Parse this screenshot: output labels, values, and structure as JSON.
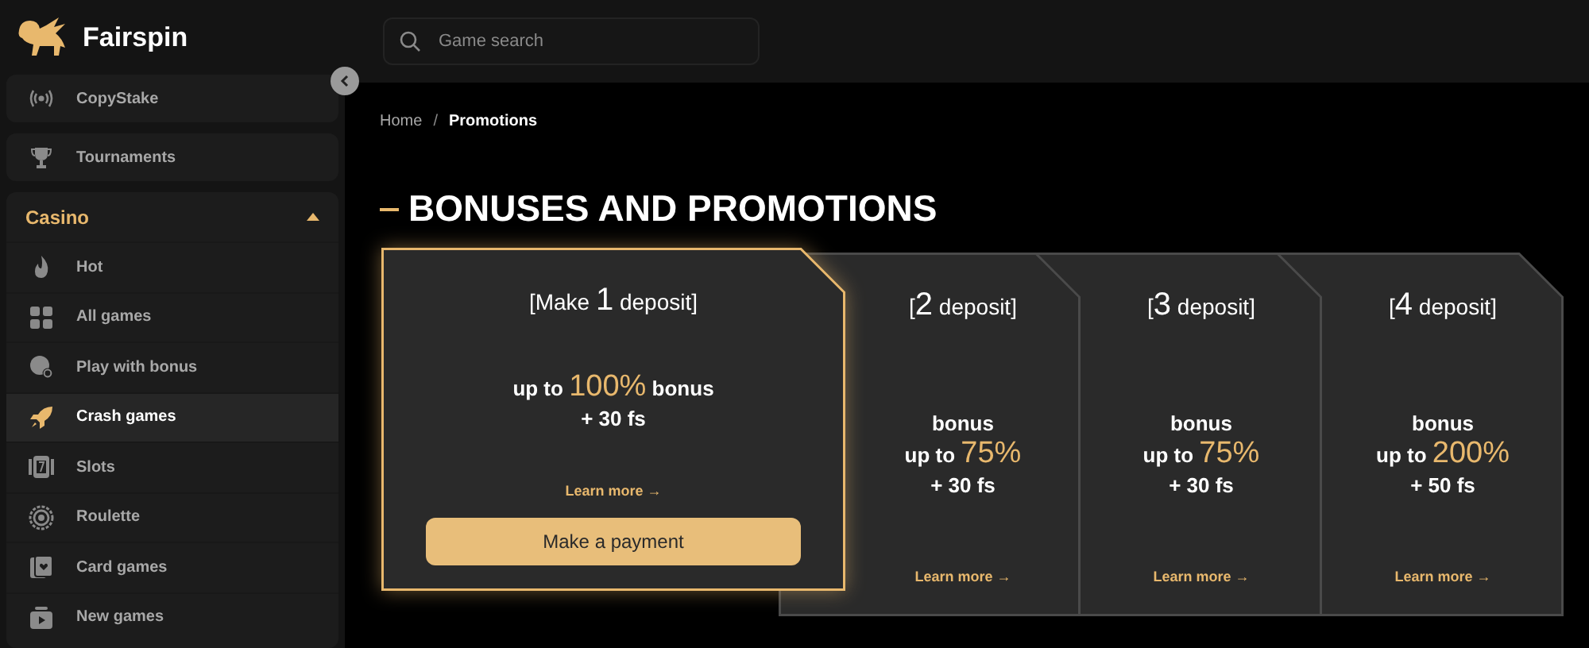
{
  "logo": {
    "text": "Fairspin"
  },
  "search": {
    "placeholder": "Game search"
  },
  "sidebar": {
    "top_items": [
      {
        "label": "CopyStake"
      },
      {
        "label": "Tournaments"
      }
    ],
    "section": {
      "title": "Casino",
      "expanded": true,
      "items": [
        {
          "label": "Hot",
          "selected": false
        },
        {
          "label": "All games",
          "selected": false
        },
        {
          "label": "Play with bonus",
          "selected": false
        },
        {
          "label": "Crash games",
          "selected": true
        },
        {
          "label": "Slots",
          "selected": false
        },
        {
          "label": "Roulette",
          "selected": false
        },
        {
          "label": "Card games",
          "selected": false
        },
        {
          "label": "New games",
          "selected": false
        }
      ]
    }
  },
  "breadcrumb": {
    "separator": "/",
    "items": [
      {
        "label": "Home",
        "current": false
      },
      {
        "label": "Promotions",
        "current": true
      }
    ]
  },
  "heading": "BONUSES AND PROMOTIONS",
  "cards": [
    {
      "selected": true,
      "title": "[Make **1** deposit]",
      "offer": [
        "up to **100%** bonus",
        "+ 30 fs"
      ],
      "link": "Learn more →",
      "button": "Make a payment"
    },
    {
      "selected": false,
      "title": "[**2** deposit]",
      "offer": [
        "bonus",
        "up to **75%**",
        "+ 30 fs"
      ],
      "link": "Learn more →"
    },
    {
      "selected": false,
      "title": "[**3** deposit]",
      "offer": [
        "bonus",
        "up to **75%**",
        "+ 30 fs"
      ],
      "link": "Learn more →"
    },
    {
      "selected": false,
      "title": "[**4** deposit]",
      "offer": [
        "bonus",
        "up to **200%**",
        "+ 50 fs"
      ],
      "link": "Learn more →"
    }
  ]
}
